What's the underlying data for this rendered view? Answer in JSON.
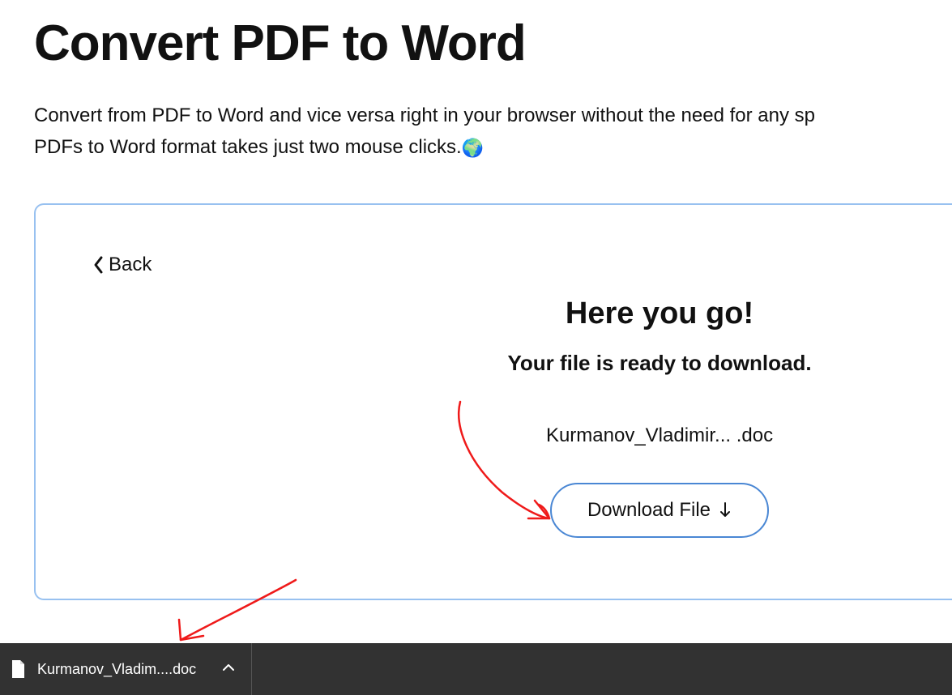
{
  "header": {
    "title": "Convert PDF to Word",
    "description_line1": "Convert from PDF to Word and vice versa right in your browser without the need for any sp",
    "description_line2": "PDFs to Word format takes just two mouse clicks.",
    "globe_emoji": "🌍"
  },
  "card": {
    "back_label": "Back",
    "success_heading": "Here you go!",
    "ready_text": "Your file is ready to download.",
    "file_name_display": "Kurmanov_Vladimir...  .doc",
    "download_button_label": "Download File"
  },
  "download_bar": {
    "item_filename": "Kurmanov_Vladim....doc"
  },
  "icons": {
    "chevron_left": "chevron-left-icon",
    "download_arrow": "download-arrow-icon",
    "chevron_up": "chevron-up-icon",
    "file_doc": "file-doc-icon"
  }
}
